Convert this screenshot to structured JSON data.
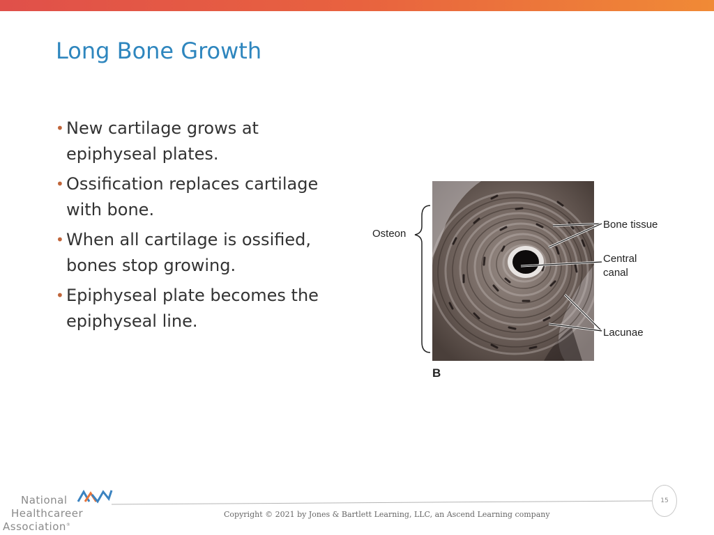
{
  "slide": {
    "title": "Long Bone Growth",
    "bullets": [
      "New cartilage grows at epiphyseal plates.",
      "Ossification replaces cartilage with bone.",
      "When all cartilage is ossified, bones stop growing.",
      "Epiphyseal plate becomes the epiphyseal line."
    ],
    "bullet_glyph": "•",
    "page_number": "15"
  },
  "figure": {
    "letter": "B",
    "labels": {
      "osteon": "Osteon",
      "bone_tissue": "Bone tissue",
      "central_canal_1": "Central",
      "central_canal_2": "canal",
      "lacunae": "Lacunae"
    }
  },
  "footer": {
    "copyright": "Copyright © 2021 by Jones & Bartlett Learning, LLC, an Ascend Learning company"
  },
  "logo": {
    "line1": "National",
    "line2": "Healthcareer",
    "line3": "Association",
    "registered": "®"
  },
  "colors": {
    "title": "#2e86be",
    "bullet": "#c0653a",
    "accent_bar_start": "#e0504a",
    "accent_bar_end": "#f08a36"
  }
}
